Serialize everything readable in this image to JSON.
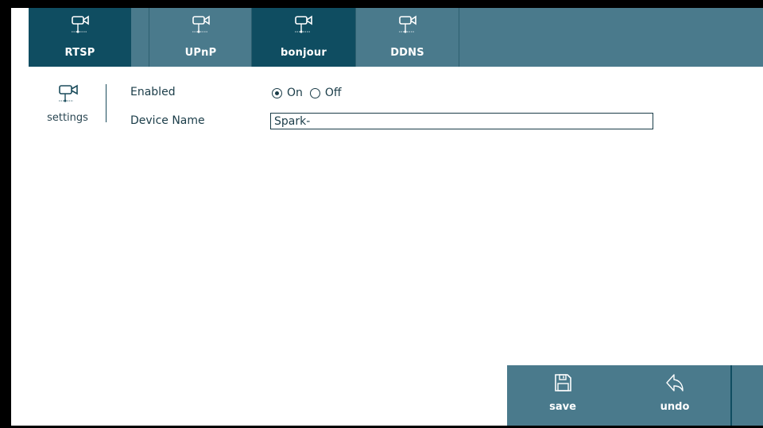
{
  "tabs": [
    {
      "label": "RTSP",
      "icon": "camera-network-icon",
      "state": "dark"
    },
    {
      "label": "UPnP",
      "icon": "camera-network-icon",
      "state": "normal"
    },
    {
      "label": "bonjour",
      "icon": "camera-network-icon",
      "state": "selected"
    },
    {
      "label": "DDNS",
      "icon": "camera-network-icon",
      "state": "normal"
    }
  ],
  "sidebar": {
    "icon": "camera-network-icon",
    "label": "settings"
  },
  "form": {
    "enabled_label": "Enabled",
    "enabled_value": "On",
    "on_label": "On",
    "off_label": "Off",
    "device_name_label": "Device Name",
    "device_name_value": "Spark-"
  },
  "toolbar": {
    "save_label": "save",
    "undo_label": "undo",
    "save_icon": "floppy-disk-icon",
    "undo_icon": "undo-arrow-icon"
  },
  "colors": {
    "tab_dark": "#0f4d61",
    "tab_normal": "#4a7a8c",
    "text": "#1a3c48",
    "frame": "#000000"
  }
}
